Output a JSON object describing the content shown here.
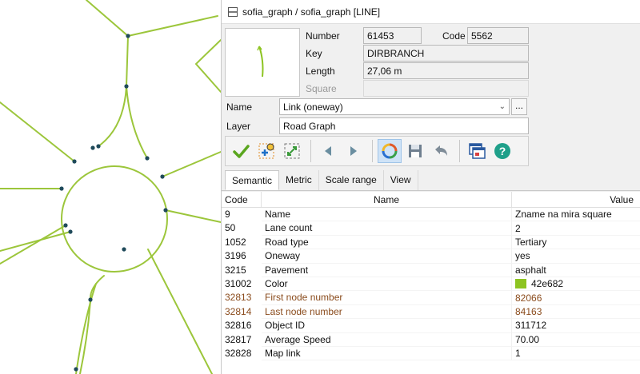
{
  "map": {
    "road_color": "#9cc63b",
    "node_color": "#1f4a5a"
  },
  "window": {
    "title": "sofia_graph / sofia_graph [LINE]"
  },
  "object": {
    "number_label": "Number",
    "number_value": "61453",
    "code_label": "Code",
    "code_value": "5562",
    "key_label": "Key",
    "key_value": "DIRBRANCH",
    "length_label": "Length",
    "length_value": "27,06 m",
    "square_label": "Square",
    "name_label": "Name",
    "name_value": "Link (oneway)",
    "layer_label": "Layer",
    "layer_value": "Road Graph",
    "more_button": "..."
  },
  "toolbar": {
    "buttons": [
      "apply-icon",
      "add-point-icon",
      "select-area-icon",
      "previous-icon",
      "next-icon",
      "refresh-icon",
      "save-icon",
      "undo-icon",
      "windows-icon",
      "help-icon"
    ]
  },
  "tabs": [
    "Semantic",
    "Metric",
    "Scale range",
    "View"
  ],
  "table": {
    "headers": {
      "code": "Code",
      "name": "Name",
      "value": "Value"
    },
    "rows": [
      {
        "code": "9",
        "name": "Name",
        "value": "Zname na mira square"
      },
      {
        "code": "50",
        "name": "Lane count",
        "value": "2"
      },
      {
        "code": "1052",
        "name": "Road type",
        "value": "Tertiary"
      },
      {
        "code": "3196",
        "name": "Oneway",
        "value": "yes"
      },
      {
        "code": "3215",
        "name": "Pavement",
        "value": "asphalt"
      },
      {
        "code": "31002",
        "name": "Color",
        "value": "42e682",
        "swatch": "#8dc421"
      },
      {
        "code": "32813",
        "name": "First node number",
        "value": "82066",
        "highlight": true
      },
      {
        "code": "32814",
        "name": "Last node number",
        "value": "84163",
        "highlight": true
      },
      {
        "code": "32816",
        "name": "Object ID",
        "value": "311712"
      },
      {
        "code": "32817",
        "name": "Average Speed",
        "value": "70.00"
      },
      {
        "code": "32828",
        "name": "Map link",
        "value": "1"
      }
    ]
  }
}
